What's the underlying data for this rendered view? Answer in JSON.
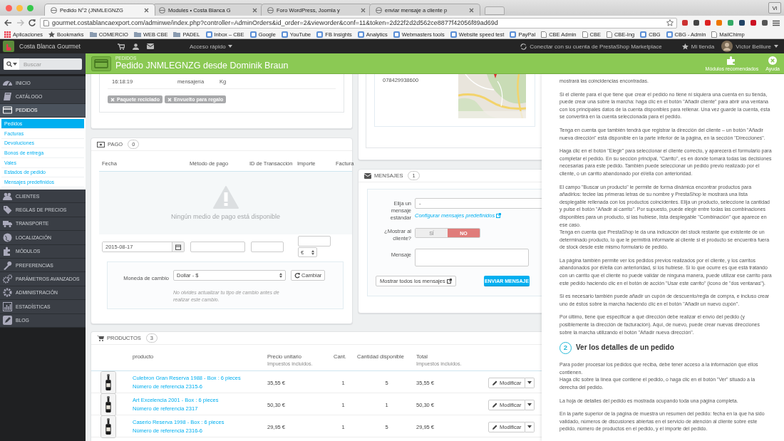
{
  "browser": {
    "tabs": [
      {
        "title": "Pedido N°2 (JNMLEGNZG",
        "selected": true
      },
      {
        "title": "Modules • Costa Blanca G",
        "selected": false
      },
      {
        "title": "Foro WordPress, Joomla y",
        "selected": false
      },
      {
        "title": "enviar mensaje a cliente p",
        "selected": false
      }
    ],
    "profile": "Vi",
    "url": "gourmet.costablancaexport.com/adminwe/index.php?controller=AdminOrders&id_order=2&vieworder&conf=11&token=2d22f2d2d562ce8877f42056f89ad69d",
    "bookmarks": [
      {
        "label": "Aplicaciones",
        "kind": "apps"
      },
      {
        "label": "Bookmarks",
        "kind": "starred"
      },
      {
        "label": "COMERCIO",
        "kind": "folder"
      },
      {
        "label": "WEB CBE",
        "kind": "folder"
      },
      {
        "label": "PADEL",
        "kind": "folder"
      },
      {
        "label": "Inbox – CBE",
        "kind": "link"
      },
      {
        "label": "Google",
        "kind": "link"
      },
      {
        "label": "YouTube",
        "kind": "link"
      },
      {
        "label": "FB Insights",
        "kind": "link"
      },
      {
        "label": "Analytics",
        "kind": "link"
      },
      {
        "label": "Webmasters tools",
        "kind": "link"
      },
      {
        "label": "Website speed test",
        "kind": "link"
      },
      {
        "label": "PayPal",
        "kind": "link"
      },
      {
        "label": "CBE Admin",
        "kind": "page"
      },
      {
        "label": "CBE",
        "kind": "page"
      },
      {
        "label": "CBE-Ing",
        "kind": "page"
      },
      {
        "label": "CBG",
        "kind": "link"
      },
      {
        "label": "CBG - Admin",
        "kind": "link"
      },
      {
        "label": "MailChimp",
        "kind": "page"
      }
    ]
  },
  "topbar": {
    "shop_name": "Costa Blanca Gourmet",
    "quick_access": "Acceso rápido",
    "marketplace": "Conectar con su cuenta de PrestaShop Marketplace",
    "my_shop": "Mi tienda",
    "user": "Víctor Belliure"
  },
  "header": {
    "search_placeholder": "Buscar",
    "section": "PEDIDOS",
    "title": "Pedido JNMLEGNZG desde Dominik Braun",
    "toolbar": [
      {
        "label": "Módulos recomendados"
      },
      {
        "label": "Ayuda"
      }
    ]
  },
  "sidebar": {
    "items": [
      {
        "label": "INICIO",
        "selected": false
      },
      {
        "label": "CATÁLOGO",
        "selected": false
      },
      {
        "label": "PEDIDOS",
        "selected": true,
        "children": [
          {
            "label": "Pedidos",
            "selected": true
          },
          {
            "label": "Facturas",
            "selected": false
          },
          {
            "label": "Devoluciones",
            "selected": false
          },
          {
            "label": "Bonos de entrega",
            "selected": false
          },
          {
            "label": "Vales",
            "selected": false
          },
          {
            "label": "Estados de pedido",
            "selected": false
          },
          {
            "label": "Mensajes predefinidos",
            "selected": false
          }
        ]
      },
      {
        "label": "CLIENTES",
        "selected": false
      },
      {
        "label": "REGLAS DE PRECIOS",
        "selected": false
      },
      {
        "label": "TRANSPORTE",
        "selected": false
      },
      {
        "label": "LOCALIZACIÓN",
        "selected": false
      },
      {
        "label": "MÓDULOS",
        "selected": false
      },
      {
        "label": "PREFERENCIAS",
        "selected": false
      },
      {
        "label": "PARÁMETROS AVANZADOS",
        "selected": false
      },
      {
        "label": "ADMINISTRACIÓN",
        "selected": false
      },
      {
        "label": "ESTADÍSTICAS",
        "selected": false
      },
      {
        "label": "BLOG",
        "selected": false
      }
    ]
  },
  "shipping": {
    "time": "16:18:19",
    "carrier": "mensajería",
    "weight": "Kg",
    "options": [
      "Paquete reciclado",
      "Envuelto para regalo"
    ]
  },
  "payment": {
    "title": "PAGO",
    "count": "0",
    "columns": [
      "Fecha",
      "Método de pago",
      "ID de Transacción",
      "Importe",
      "Factura"
    ],
    "empty": "Ningún medio de pago está disponible",
    "date": "2015-08-17",
    "currency": "€",
    "exchange": {
      "label": "Moneda de cambio",
      "value": "Dollar - $",
      "button": "Cambiar",
      "help": "No olvides actualizar tu tipo de cambio antes de realizar este cambio."
    }
  },
  "address": {
    "phone": "078429938600"
  },
  "messages": {
    "title": "MENSAJES",
    "count": "1",
    "standard_label": "Elija un mensaje estándar",
    "standard_value": "-",
    "config_link": "Configurar mensajes predefinidos",
    "show_label": "¿Mostrar al cliente?",
    "options": [
      {
        "label": "SÍ",
        "selected": false
      },
      {
        "label": "NO",
        "selected": true
      }
    ],
    "message_label": "Mensaje",
    "show_all": "Mostrar todos los mensajes",
    "send": "ENVIAR MENSAJE"
  },
  "products": {
    "title": "PRODUCTOS",
    "count": "3",
    "columns": [
      {
        "label": "producto"
      },
      {
        "label": "Precio unitario",
        "note": "Impuestos incluidos."
      },
      {
        "label": "Cant."
      },
      {
        "label": "Cantidad disponible"
      },
      {
        "label": "Total",
        "note": "Impuestos incluidos."
      }
    ],
    "rows": [
      {
        "name": "Culebron Gran Reserva 1988 - Box : 6 pieces",
        "reference": "Número de referencia 2315-6",
        "price": "35,55 €",
        "qty": "1",
        "available": "5",
        "total": "35,55 €",
        "action": "Modificar"
      },
      {
        "name": "Art Excelencia 2001 - Box : 6 pieces",
        "reference": "Número de referencia 2317",
        "price": "50,30 €",
        "qty": "1",
        "available": "1",
        "total": "50,30 €",
        "action": "Modificar"
      },
      {
        "name": "Caserio Reserva 1998 - Box : 6 pieces",
        "reference": "Número de referencia 2316-6",
        "price": "29,95 €",
        "qty": "1",
        "available": "5",
        "total": "29,95 €",
        "action": "Modificar"
      }
    ]
  },
  "help": {
    "blocks": [
      {
        "kind": "paragraph",
        "text": "mostrará las coincidencias encontradas."
      },
      {
        "kind": "paragraph",
        "text": "Si el cliente para el que tiene que crear el pedido no tiene ni siquiera una cuenta en su tienda, puede crear una sobre la marcha: haga clic en el botón \"Añadir cliente\" para abrir una ventana con los principales datos de la cuenta disponibles para rellenar. Una vez guarde la cuenta, ésta se convertirá en la cuenta seleccionada para el pedido."
      },
      {
        "kind": "paragraph",
        "text": "Tenga en cuenta que también tendrá que registrar la dirección del cliente – un botón \"Añadir nueva dirección\" está disponible en la parte inferior de la página, en la sección \"Direcciones\"."
      },
      {
        "kind": "paragraph",
        "text": "Haga clic en el botón \"Elegir\" para seleccionar el cliente correcto, y aparecerá el formulario para completar el pedido. En su sección principal, \"Carrito\", es en donde tomará todas las decisiones necesarias para este pedido. También puede seleccionar un pedido previo realizado por el cliente, o un carrito abandonado por él/ella con anterioridad."
      },
      {
        "kind": "paragraph",
        "text": "El campo \"Buscar un producto\" le permite de forma dinámica encontrar productos para añadirlos: teclee las primeras letras de su nombre y PrestaShop le mostrará una lista desplegable rellenada con los productos coincidentes. Elija un producto, seleccione la cantidad y pulse el botón \"Añadir al carrito\". Por supuesto, puede elegir entre todas las combinaciones disponibles para un producto, si las hubiese, lista desplegable \"Combinación\" que aparece en ese caso.\nTenga en cuenta que PrestaShop le da una indicación del stock restante que existente de un determinado producto, lo que le permitirá informarle al cliente si el producto se encuentra fuera de stock desde este mismo formulario de pedido."
      },
      {
        "kind": "paragraph",
        "text": "La página también permite ver los pedidos previos realizados por el cliente, y los carritos abandonados por él/ella con anterioridad, si los hubiese. Si lo que ocurre es que está tratando con un carrito que el cliente no puede validar de ninguna manera, puede utilizar ese carrito para este pedido haciendo clic en el botón de acción \"Usar este carrito\" (icono de \"dos ventanas\")."
      },
      {
        "kind": "paragraph",
        "text": "Si es necesario también puede añadir un cupón de descuento/regla de compra, e incluso crear uno de éstos sobre la marcha haciendo clic en el botón \"Añadir un nuevo cupón\"."
      },
      {
        "kind": "paragraph",
        "text": "Por último, tiene que especificar a qué dirección debe realizar el envío del pedido (y posiblemente la dirección de facturación). Aquí, de nuevo, puede crear nuevas direcciones sobre la marcha utilizando el botón \"Añadir nueva dirección\"."
      },
      {
        "kind": "heading",
        "number": "2",
        "text": "Ver los detalles de un pedido"
      },
      {
        "kind": "paragraph",
        "text": "Para poder procesar los pedidos que reciba, debe tener acceso a la información que ellos contienen.\nHaga clic sobre la línea que contiene el pedido, o haga clic en el botón \"Ver\" situado a la derecha del pedido."
      },
      {
        "kind": "paragraph",
        "text": "La hoja de detalles del pedido es mostrada ocupando toda una página completa."
      },
      {
        "kind": "paragraph",
        "text": "En la parte superior de la página de muestra un resumen del pedido: fecha en la que ha sido validado, números de discusiones abiertas en el servicio de atención al cliente sobre este pedido, número de productos en el pedido, y el importe del pedido."
      }
    ]
  }
}
